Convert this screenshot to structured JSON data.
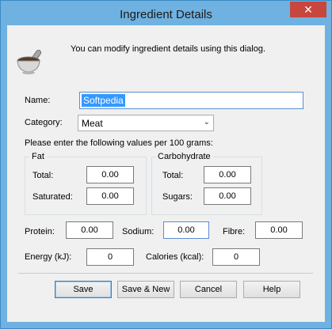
{
  "window": {
    "title": "Ingredient Details",
    "close_glyph": "✕"
  },
  "intro": {
    "icon": "mortar-pestle-icon",
    "text": "You can modify ingredient details using this dialog."
  },
  "name": {
    "label": "Name:",
    "value": "Softpedia"
  },
  "category": {
    "label": "Category:",
    "value": "Meat",
    "arrow": "⌄"
  },
  "per_100g_text": "Please enter the following values per 100 grams:",
  "fat": {
    "title": "Fat",
    "total_label": "Total:",
    "total_value": "0.00",
    "saturated_label": "Saturated:",
    "saturated_value": "0.00"
  },
  "carbohydrate": {
    "title": "Carbohydrate",
    "total_label": "Total:",
    "total_value": "0.00",
    "sugars_label": "Sugars:",
    "sugars_value": "0.00"
  },
  "protein": {
    "label": "Protein:",
    "value": "0.00"
  },
  "sodium": {
    "label": "Sodium:",
    "value": "0.00"
  },
  "fibre": {
    "label": "Fibre:",
    "value": "0.00"
  },
  "energy": {
    "label": "Energy (kJ):",
    "value": "0"
  },
  "calories": {
    "label": "Calories (kcal):",
    "value": "0"
  },
  "buttons": {
    "save": "Save",
    "save_new": "Save & New",
    "cancel": "Cancel",
    "help": "Help"
  },
  "colors": {
    "title_bar": "#6fb1e0",
    "close_button": "#c7463e",
    "selection": "#3399ff",
    "dialog_bg": "#f0f0f0"
  }
}
